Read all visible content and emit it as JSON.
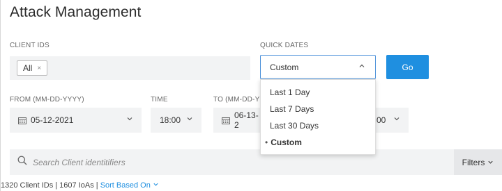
{
  "page": {
    "title": "Attack Management"
  },
  "client_ids": {
    "label": "CLIENT IDS",
    "chip_label": "All",
    "chip_close": "×"
  },
  "quick_dates": {
    "label": "QUICK DATES",
    "selected": "Custom",
    "options": [
      "Last 1 Day",
      "Last 7 Days",
      "Last 30 Days",
      "Custom"
    ],
    "bullet": "•"
  },
  "go_button": {
    "label": "Go"
  },
  "from": {
    "label": "FROM (MM-DD-YYYY)",
    "value": "05-12-2021"
  },
  "time_from": {
    "label": "TIME",
    "value": "18:00"
  },
  "to": {
    "label": "TO (MM-DD-Y",
    "value": "06-13-2"
  },
  "time_to": {
    "value_partial": "00"
  },
  "search": {
    "placeholder": "Search Client identitifiers"
  },
  "filters_button": {
    "label": "Filters"
  },
  "summary": {
    "text": "1320 Client IDs | 1607 IoAs | ",
    "sort_label": "Sort Based On"
  },
  "colors": {
    "accent": "#1f8fe0",
    "field_bg": "#f2f3f4"
  },
  "icons": [
    "close-icon",
    "chevron-up-icon",
    "chevron-down-icon",
    "calendar-icon",
    "search-icon"
  ]
}
